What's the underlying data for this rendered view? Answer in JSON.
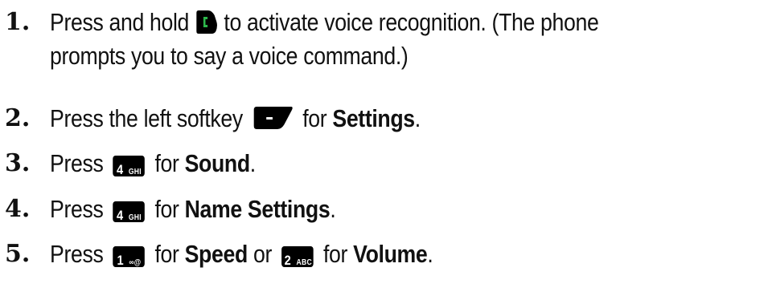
{
  "steps": [
    {
      "number": "1.",
      "text_before": "Press and hold",
      "icon": "talk-key-icon",
      "text_after": "to activate voice recognition. (The phone",
      "line2": "prompts you to say a voice command.)"
    },
    {
      "number": "2.",
      "text_before": "Press the left softkey",
      "icon": "left-softkey-icon",
      "text_mid": "for",
      "bold": "Settings",
      "end": "."
    },
    {
      "number": "3.",
      "text_before": "Press",
      "key_main": "4",
      "key_letters": "GHI",
      "text_mid": "for",
      "bold": "Sound",
      "end": "."
    },
    {
      "number": "4.",
      "text_before": "Press",
      "key_main": "4",
      "key_letters": "GHI",
      "text_mid": "for",
      "bold": "Name Settings",
      "end": "."
    },
    {
      "number": "5.",
      "text_before": "Press",
      "key1_main": "1",
      "key1_symbols": "∞@",
      "text_mid": "for",
      "bold": "Speed",
      "text_or": "or",
      "key2_main": "2",
      "key2_letters": "ABC",
      "text_mid2": "for",
      "bold2": "Volume",
      "end": "."
    }
  ],
  "colors": {
    "text": "#111111",
    "key_bg": "#000000",
    "talk_icon_green": "#2db84b"
  }
}
